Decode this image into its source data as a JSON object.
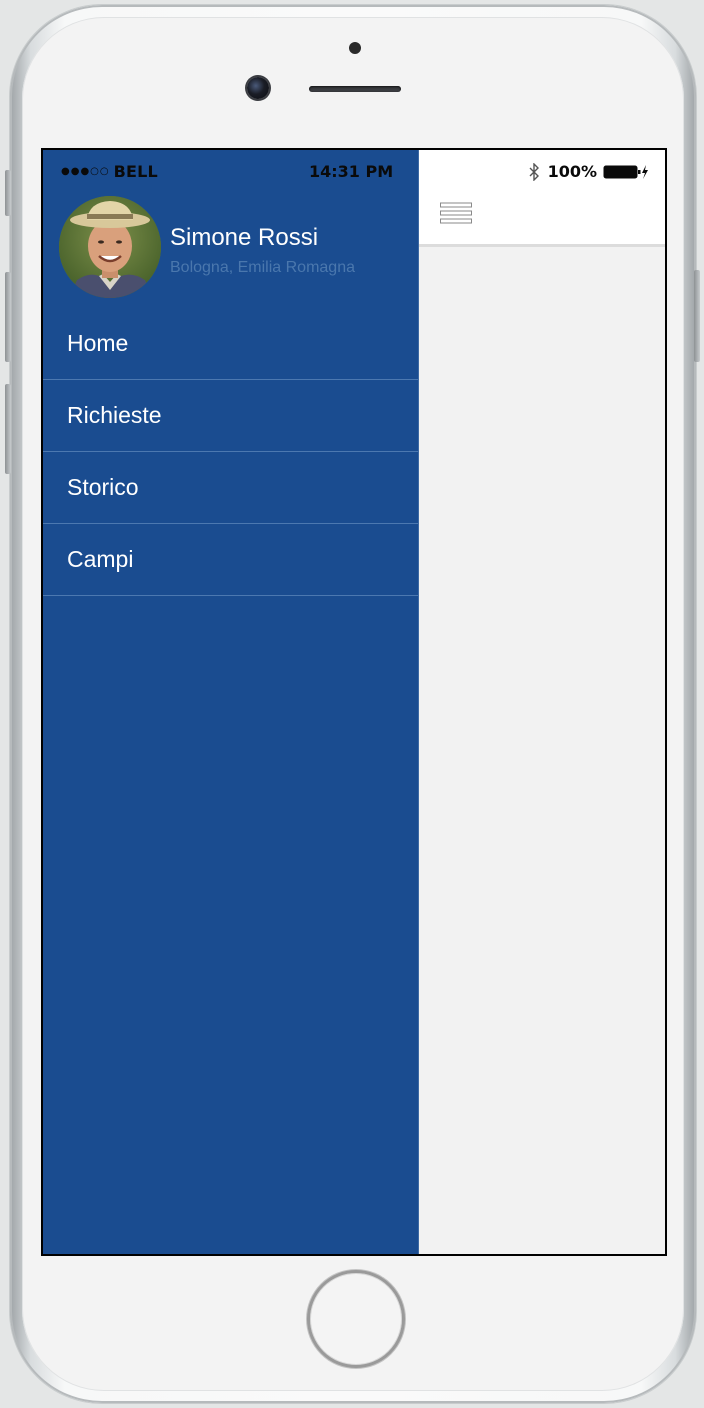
{
  "status_bar": {
    "carrier": "BELL",
    "time": "14:31 PM",
    "battery": "100%"
  },
  "user": {
    "name": "Simone Rossi",
    "location": "Bologna, Emilia Romagna"
  },
  "menu": {
    "items": [
      {
        "label": "Home"
      },
      {
        "label": "Richieste"
      },
      {
        "label": "Storico"
      },
      {
        "label": "Campi"
      }
    ]
  },
  "icons": {
    "menu": "hamburger-icon",
    "bluetooth": "bluetooth-icon",
    "battery": "battery-icon",
    "charging": "charging-bolt-icon",
    "signal": "signal-dots-icon"
  },
  "colors": {
    "drawer_background": "#1a4c90",
    "divider": "#4c78b0",
    "location_text": "#4a77ad",
    "main_background": "#f2f2f2"
  }
}
